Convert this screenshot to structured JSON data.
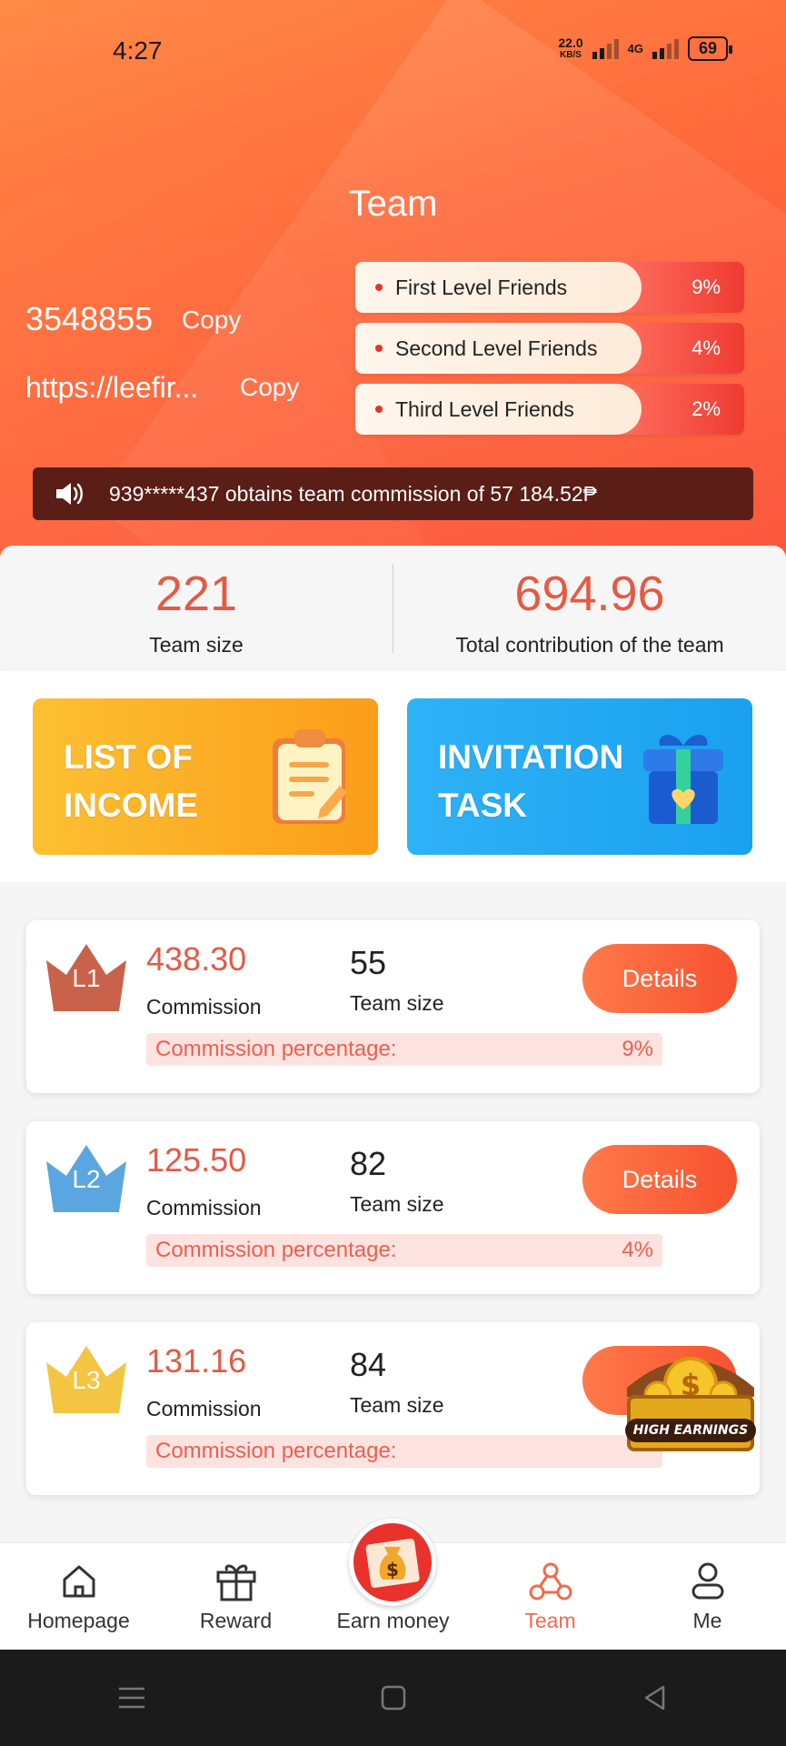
{
  "status_bar": {
    "time": "4:27",
    "net_speed": "22.0",
    "net_unit": "KB/S",
    "network": "4G",
    "battery": "69"
  },
  "header": {
    "title": "Team",
    "invite_code": "3548855",
    "copy_code_label": "Copy",
    "invite_link": "https://leefir...",
    "copy_link_label": "Copy",
    "levels": [
      {
        "label": "First Level Friends",
        "percent": "9%"
      },
      {
        "label": "Second Level Friends",
        "percent": "4%"
      },
      {
        "label": "Third Level Friends",
        "percent": "2%"
      }
    ],
    "ticker": "939*****437 obtains team commission of 57 184.52₱"
  },
  "stats": {
    "team_size_value": "221",
    "team_size_label": "Team size",
    "contribution_value": "694.96",
    "contribution_label": "Total contribution of the team"
  },
  "promos": {
    "income": {
      "line1": "LIST OF",
      "line2": "INCOME",
      "icon": "clipboard-icon",
      "color": "#fdb02a"
    },
    "task": {
      "line1": "INVITATION",
      "line2": "TASK",
      "icon": "gift-icon",
      "color": "#25a9f2"
    }
  },
  "levels_detail": [
    {
      "badge": "L1",
      "commission": "438.30",
      "commission_label": "Commission",
      "team_size": "55",
      "team_size_label": "Team size",
      "details_label": "Details",
      "pct_label": "Commission percentage:",
      "pct_value": "9%",
      "crown_color": "#c9624a"
    },
    {
      "badge": "L2",
      "commission": "125.50",
      "commission_label": "Commission",
      "team_size": "82",
      "team_size_label": "Team size",
      "details_label": "Details",
      "pct_label": "Commission percentage:",
      "pct_value": "4%",
      "crown_color": "#5aa6e0"
    },
    {
      "badge": "L3",
      "commission": "131.16",
      "commission_label": "Commission",
      "team_size": "84",
      "team_size_label": "Team size",
      "details_label": "",
      "pct_label": "Commission percentage:",
      "pct_value": "",
      "crown_color": "#f4c542"
    }
  ],
  "floating_badge": {
    "label": "HIGH EARNINGS"
  },
  "bottom_nav": {
    "items": [
      {
        "label": "Homepage",
        "icon": "home-icon"
      },
      {
        "label": "Reward",
        "icon": "gift-icon"
      },
      {
        "label": "Earn money",
        "icon": "money-bag-icon"
      },
      {
        "label": "Team",
        "icon": "team-icon"
      },
      {
        "label": "Me",
        "icon": "user-icon"
      }
    ],
    "active": "Team",
    "accent": "#f56a4a"
  }
}
